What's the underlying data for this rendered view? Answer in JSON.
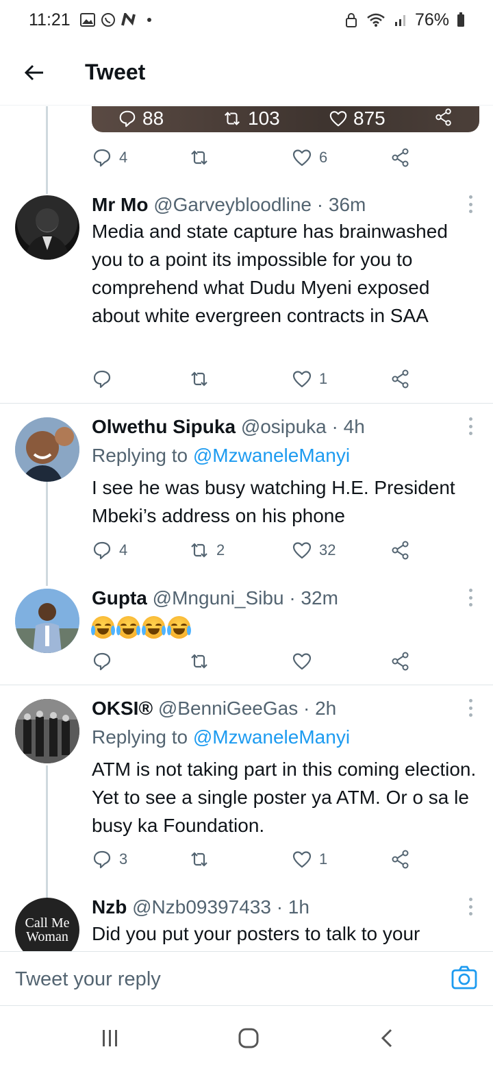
{
  "status_bar": {
    "time": "11:21",
    "battery": "76%",
    "icons": [
      "gallery-icon",
      "whatsapp-icon",
      "n-app-icon",
      "dot-icon",
      "lock-icon",
      "wifi-icon",
      "signal-icon",
      "battery-icon"
    ]
  },
  "header": {
    "title": "Tweet",
    "back_icon": "arrow-left-icon"
  },
  "quoted_stats": {
    "replies": "88",
    "retweets": "103",
    "likes": "875"
  },
  "parent_actions": {
    "replies": "4",
    "retweets": "",
    "likes": "6"
  },
  "tweets": [
    {
      "name": "Mr Mo",
      "handle": "@Garveybloodline",
      "time": "· 36m",
      "replying_to": "",
      "text": "Media and state capture has brainwashed you to a point its impossible for you to comprehend what Dudu Myeni exposed about white evergreen contracts in SAA",
      "replies": "",
      "retweets": "",
      "likes": "1"
    },
    {
      "name": "Olwethu Sipuka",
      "handle": "@osipuka",
      "time": "· 4h",
      "replying_prefix": "Replying to",
      "replying_to": "@MzwaneleManyi",
      "text": "I see he was busy watching H.E. President Mbeki’s address on his phone",
      "replies": "4",
      "retweets": "2",
      "likes": "32"
    },
    {
      "name": "Gupta",
      "handle": "@Mnguni_Sibu",
      "time": "· 32m",
      "replying_to": "",
      "text": "😂😂😂😂",
      "replies": "",
      "retweets": "",
      "likes": ""
    },
    {
      "name": "OKSI®",
      "handle": "@BenniGeeGas",
      "time": "· 2h",
      "replying_prefix": "Replying to",
      "replying_to": "@MzwaneleManyi",
      "text": "ATM is not taking part in this coming election. Yet to see a single poster ya ATM. Or o sa le busy ka Foundation.",
      "replies": "3",
      "retweets": "",
      "likes": "1"
    },
    {
      "name": "Nzb",
      "handle": "@Nzb09397433",
      "time": "· 1h",
      "replying_to": "",
      "avatar_text": "Call Me Woman",
      "text": "Did you put your posters to talk to your"
    }
  ],
  "composer": {
    "placeholder": "Tweet your reply",
    "camera_icon": "camera-icon"
  },
  "nav": [
    "recent-apps-icon",
    "home-icon",
    "back-icon"
  ],
  "colors": {
    "accent": "#1d9bf0",
    "text": "#0f1419",
    "secondary": "#536471",
    "thread_line": "#cfd9de"
  }
}
